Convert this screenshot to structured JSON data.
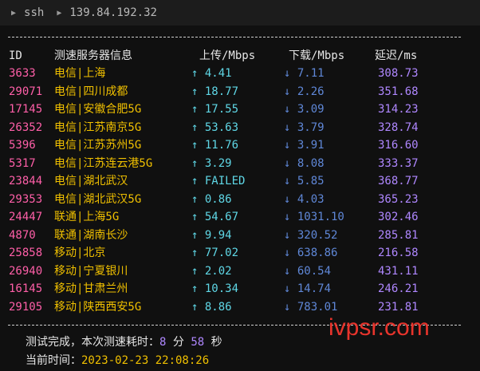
{
  "topbar": {
    "cmd": "ssh",
    "host": "139.84.192.32"
  },
  "header": {
    "id": "ID",
    "server": "测速服务器信息",
    "upload": "上传/Mbps",
    "download": "下载/Mbps",
    "ping": "延迟/ms"
  },
  "rows": [
    {
      "id": "3633",
      "server": "电信|上海",
      "up": "↑ 4.41",
      "down": "↓ 7.11",
      "ping": "308.73"
    },
    {
      "id": "29071",
      "server": "电信|四川成都",
      "up": "↑ 18.77",
      "down": "↓ 2.26",
      "ping": "351.68"
    },
    {
      "id": "17145",
      "server": "电信|安徽合肥5G",
      "up": "↑ 17.55",
      "down": "↓ 3.09",
      "ping": "314.23"
    },
    {
      "id": "26352",
      "server": "电信|江苏南京5G",
      "up": "↑ 53.63",
      "down": "↓ 3.79",
      "ping": "328.74"
    },
    {
      "id": "5396",
      "server": "电信|江苏苏州5G",
      "up": "↑ 11.76",
      "down": "↓ 3.91",
      "ping": "316.60"
    },
    {
      "id": "5317",
      "server": "电信|江苏连云港5G",
      "up": "↑ 3.29",
      "down": "↓ 8.08",
      "ping": "333.37"
    },
    {
      "id": "23844",
      "server": "电信|湖北武汉",
      "up": "↑ FAILED",
      "down": "↓ 5.85",
      "ping": "368.77"
    },
    {
      "id": "29353",
      "server": "电信|湖北武汉5G",
      "up": "↑ 0.86",
      "down": "↓ 4.03",
      "ping": "365.23"
    },
    {
      "id": "24447",
      "server": "联通|上海5G",
      "up": "↑ 54.67",
      "down": "↓ 1031.10",
      "ping": "302.46"
    },
    {
      "id": "4870",
      "server": "联通|湖南长沙",
      "up": "↑ 9.94",
      "down": "↓ 320.52",
      "ping": "285.81"
    },
    {
      "id": "25858",
      "server": "移动|北京",
      "up": "↑ 77.02",
      "down": "↓ 638.86",
      "ping": "216.58"
    },
    {
      "id": "26940",
      "server": "移动|宁夏银川",
      "up": "↑ 2.02",
      "down": "↓ 60.54",
      "ping": "431.11"
    },
    {
      "id": "16145",
      "server": "移动|甘肃兰州",
      "up": "↑ 10.34",
      "down": "↓ 14.74",
      "ping": "246.21"
    },
    {
      "id": "29105",
      "server": "移动|陕西西安5G",
      "up": "↑ 8.86",
      "down": "↓ 783.01",
      "ping": "231.81"
    }
  ],
  "footer": {
    "done_label": "测试完成，本次测速耗时：",
    "minutes": "8",
    "min_unit": "分",
    "seconds": "58",
    "sec_unit": "秒",
    "time_label": "当前时间：",
    "time_value": "2023-02-23 22:08:26"
  },
  "watermark": "ivpsr.com"
}
